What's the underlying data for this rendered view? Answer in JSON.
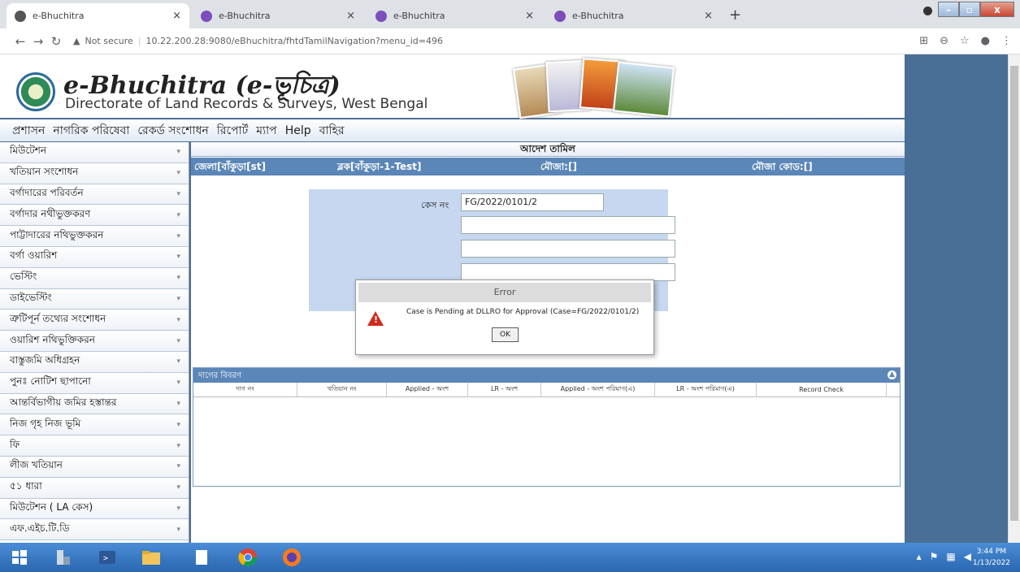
{
  "browser": {
    "tabs": [
      {
        "title": "e-Bhuchitra",
        "close": "×"
      },
      {
        "title": "e-Bhuchitra",
        "close": "×"
      },
      {
        "title": "e-Bhuchitra",
        "close": "×"
      },
      {
        "title": "e-Bhuchitra",
        "close": "×"
      }
    ],
    "new_tab": "+",
    "window_controls": {
      "minimize": "–",
      "maximize": "▫",
      "close": "x"
    },
    "security": "Not secure",
    "url": "10.22.200.28:9080/eBhuchitra/fhtdTamilNavigation?menu_id=496"
  },
  "site": {
    "brand": "e-Bhuchitra (e-ভূচিত্র)",
    "subtitle": "Directorate of Land Records & Surveys, West Bengal"
  },
  "menu": [
    "প্রশাসন",
    "নাগরিক পরিষেবা",
    "রেকর্ড সংশোধন",
    "রিপোর্ট",
    "ম্যাপ",
    "Help",
    "বাহির"
  ],
  "sidebar": [
    "মিউটেশন",
    "খতিয়ান সংশোধন",
    "বর্গাদারের পরিবর্তন",
    "বর্গাদার নথীভুক্তকরণ",
    "পাট্টাদারের নথিভুক্তকরন",
    "বর্গা ওয়ারিশ",
    "ভেস্টিং",
    "ডাইভেস্টিং",
    "ত্রুটিপূর্ন তথ্যের সংশোধন",
    "ওয়ারিশ নথিভুক্তিকরন",
    "বাস্তুজমি অধিগ্রহন",
    "পুনঃ নোটিশ ছাপানো",
    "আন্তর্বিভাগীয় জমির হস্তান্তর",
    "নিজ গৃহ নিজ ভূমি",
    "ফি",
    "লীজ খতিয়ান",
    "৫১ ধারা",
    "মিউটেশন ( LA কেস)",
    "এফ.এইচ.টি.ডি"
  ],
  "main": {
    "title": "আদেশ তামিল",
    "info": {
      "district": "জেলা[বাঁকুড়া[st]",
      "block": "ব্লক[বাঁকুড়া-1-Test]",
      "mouza": "মৌজা:[]",
      "mouza_code": "মৌজা কোড:[]"
    },
    "case_label": "কেস নং",
    "case_value": "FG/2022/0101/2",
    "land_panel_title": "দাগের বিবরণ",
    "columns": [
      "দাগ নং",
      "খতিয়ান নং",
      "Applied - অংশ",
      "LR - অংশ",
      "Applied - অংশ পরিমাণ(এ)",
      "LR - অংশ পরিমাণ(এ)",
      "Record Check"
    ]
  },
  "dialog": {
    "title": "Error",
    "message": "Case is Pending at DLLRO for Approval (Case=FG/2022/0101/2)",
    "ok": "OK"
  },
  "taskbar": {
    "time": "3:44 PM",
    "date": "1/13/2022"
  },
  "colors": {
    "accent": "#5b86b8",
    "page_bg": "#4a6f96",
    "error": "#d12b1e"
  }
}
